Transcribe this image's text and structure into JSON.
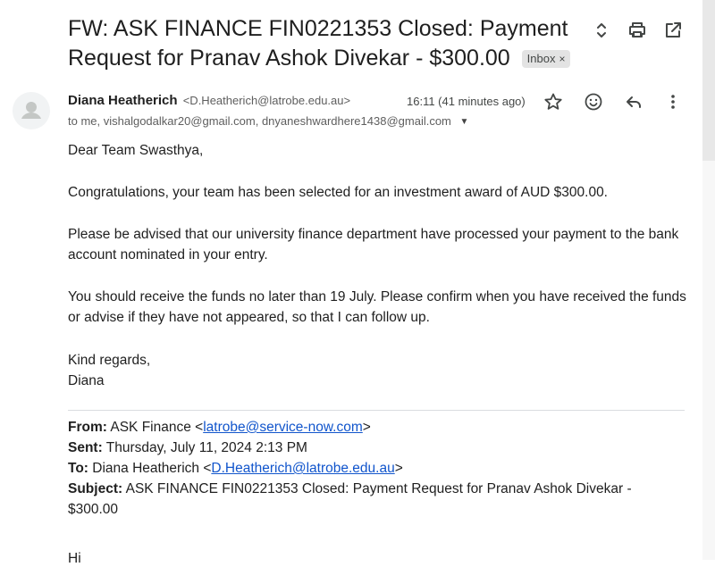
{
  "email": {
    "subject": "FW: ASK FINANCE FIN0221353 Closed: Payment Request for Pranav Ashok Divekar - $300.00",
    "label_chip": "Inbox",
    "label_chip_close": "×",
    "sender": {
      "name": "Diana Heatherich",
      "email": "<D.Heatherich@latrobe.edu.au>"
    },
    "time": "16:11 (41 minutes ago)",
    "recipients": "to me, vishalgodalkar20@gmail.com, dnyaneshwardhere1438@gmail.com",
    "body": {
      "greeting": "Dear Team Swasthya,",
      "p1": "Congratulations, your team has been selected for an investment award of AUD $300.00.",
      "p2": "Please be advised that our university finance department have processed your payment to the bank account nominated in your entry.",
      "p3": "You should receive the funds no later than 19 July.  Please confirm when you have received the funds or advise if they have not appeared, so that I can follow up.",
      "closing": "Kind regards,",
      "signature": "Diana"
    },
    "forwarded": {
      "from_label": "From:",
      "from_name": "ASK Finance <",
      "from_email": "latrobe@service-now.com",
      "from_end": ">",
      "sent_label": "Sent:",
      "sent_value": "Thursday, July 11, 2024 2:13 PM",
      "to_label": "To:",
      "to_name": "Diana Heatherich <",
      "to_email": "D.Heatherich@latrobe.edu.au",
      "to_end": ">",
      "subject_label": "Subject:",
      "subject_value": "ASK FINANCE FIN0221353 Closed: Payment Request for Pranav Ashok Divekar - $300.00"
    },
    "cut_off_text": "Hi"
  },
  "icons": {
    "expand": "unfold-icon",
    "print": "print-icon",
    "open_new": "open-in-new-icon",
    "star": "star-icon",
    "emoji": "emoji-icon",
    "reply": "reply-icon",
    "more": "more-vert-icon",
    "avatar": "person-icon"
  }
}
